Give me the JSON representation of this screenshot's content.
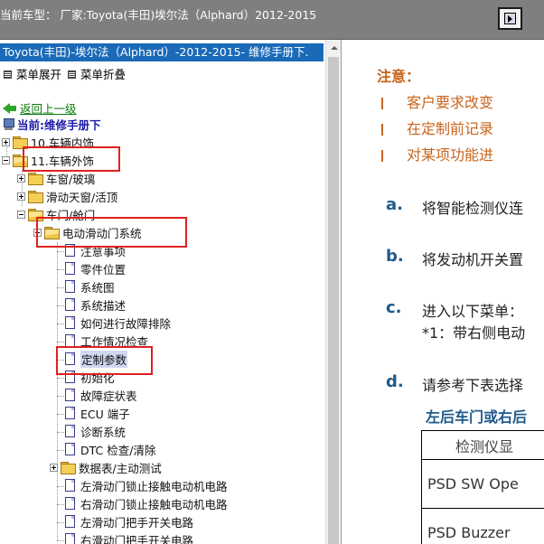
{
  "topbar": {
    "title": "当前车型： 厂家:Toyota(丰田)埃尔法（Alphard）2012-2015"
  },
  "tree_panel": {
    "banner": "Toyota(丰田)-埃尔法（Alphard）-2012-2015- 维修手册下.",
    "expand_label": "菜单展开",
    "collapse_label": "菜单折叠",
    "back_label": "返回上一级",
    "current_label": "当前:维修手册下",
    "items": [
      {
        "label": "10.车辆内饰"
      },
      {
        "label": "11.车辆外饰"
      },
      {
        "label": "车窗/玻璃"
      },
      {
        "label": "滑动天窗/活顶"
      },
      {
        "label": "车门/舱门"
      },
      {
        "label": "电动滑动门系统"
      },
      {
        "label": "注意事项"
      },
      {
        "label": "零件位置"
      },
      {
        "label": "系统图"
      },
      {
        "label": "系统描述"
      },
      {
        "label": "如何进行故障排除"
      },
      {
        "label": "工作情况检查"
      },
      {
        "label": "定制参数"
      },
      {
        "label": "初始化"
      },
      {
        "label": "故障症状表"
      },
      {
        "label": "ECU 端子"
      },
      {
        "label": "诊断系统"
      },
      {
        "label": "DTC 检查/清除"
      },
      {
        "label": "数据表/主动测试"
      },
      {
        "label": "左滑动门锁止接触电动机电路"
      },
      {
        "label": "右滑动门锁止接触电动机电路"
      },
      {
        "label": "左滑动门把手开关电路"
      },
      {
        "label": "右滑动门把手开关电路"
      }
    ]
  },
  "content": {
    "note_title": "注意：",
    "notes": [
      "客户要求改变",
      "在定制前记录",
      "对某项功能进"
    ],
    "steps": [
      {
        "letter": "a.",
        "text": "将智能检测仪连"
      },
      {
        "letter": "b.",
        "text": "将发动机开关置"
      },
      {
        "letter": "c.",
        "text": "进入以下菜单：",
        "text2": "*1：带右侧电动"
      },
      {
        "letter": "d.",
        "text": "请参考下表选择"
      }
    ],
    "table_title": "左后车门或右后",
    "table": {
      "header": "检测仪显",
      "rows": [
        "PSD SW Ope",
        "PSD Buzzer"
      ]
    }
  },
  "colors": {
    "banner_bg": "#1b6ab8",
    "note_orange": "#c8641c",
    "step_blue": "#1f5a8c",
    "highlight_red": "#e02020"
  }
}
